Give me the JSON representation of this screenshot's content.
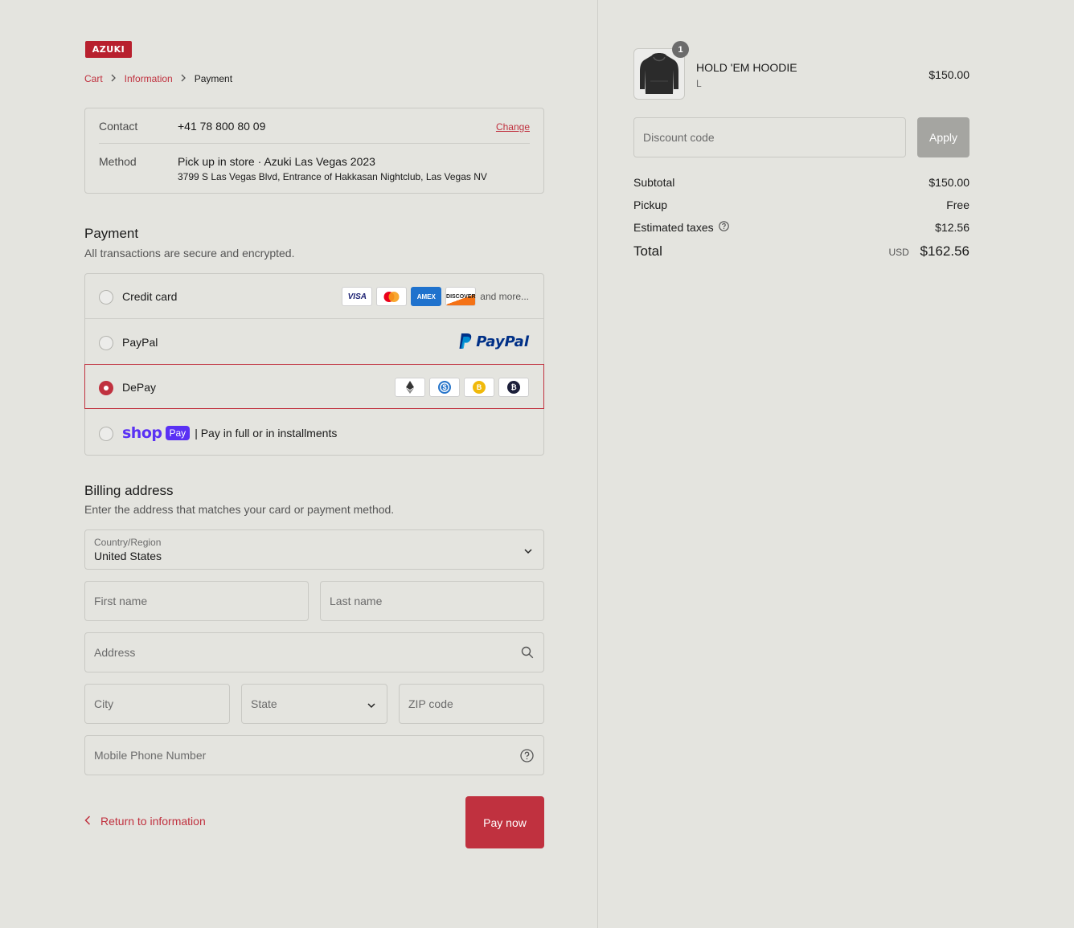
{
  "brand": {
    "logo_text": "AZUKI",
    "accent": "#c0313f"
  },
  "breadcrumb": {
    "cart": "Cart",
    "information": "Information",
    "payment": "Payment"
  },
  "review": {
    "contact_label": "Contact",
    "contact_value": "+41 78 800 80 09",
    "change_label": "Change",
    "method_label": "Method",
    "method_value": "Pick up in store · Azuki Las Vegas 2023",
    "method_address": "3799 S Las Vegas Blvd, Entrance of Hakkasan Nightclub, Las Vegas NV"
  },
  "payment": {
    "title": "Payment",
    "subtitle": "All transactions are secure and encrypted.",
    "options": [
      {
        "label": "Credit card",
        "selected": false
      },
      {
        "label": "PayPal",
        "selected": false
      },
      {
        "label": "DePay",
        "selected": true
      },
      {
        "label": "| Pay in full or in installments",
        "selected": false
      }
    ],
    "cards": [
      "VISA",
      "AMEX",
      "DISCOVER"
    ],
    "more": "and more...",
    "paypal_logo": "PayPal",
    "shop_word": "shop",
    "shop_badge": "Pay"
  },
  "billing": {
    "title": "Billing address",
    "subtitle": "Enter the address that matches your card or payment method.",
    "country_label": "Country/Region",
    "country_value": "United States",
    "first_name": "First name",
    "last_name": "Last name",
    "address": "Address",
    "city": "City",
    "state": "State",
    "zip": "ZIP code",
    "phone": "Mobile Phone Number"
  },
  "actions": {
    "back": "Return to information",
    "pay": "Pay now"
  },
  "summary": {
    "quantity": "1",
    "product_name": "HOLD 'EM HOODIE",
    "product_variant": "L",
    "product_price": "$150.00",
    "discount_placeholder": "Discount code",
    "apply": "Apply",
    "subtotal_label": "Subtotal",
    "subtotal_value": "$150.00",
    "pickup_label": "Pickup",
    "pickup_value": "Free",
    "taxes_label": "Estimated taxes",
    "taxes_value": "$12.56",
    "total_label": "Total",
    "total_currency": "USD",
    "total_value": "$162.56"
  }
}
